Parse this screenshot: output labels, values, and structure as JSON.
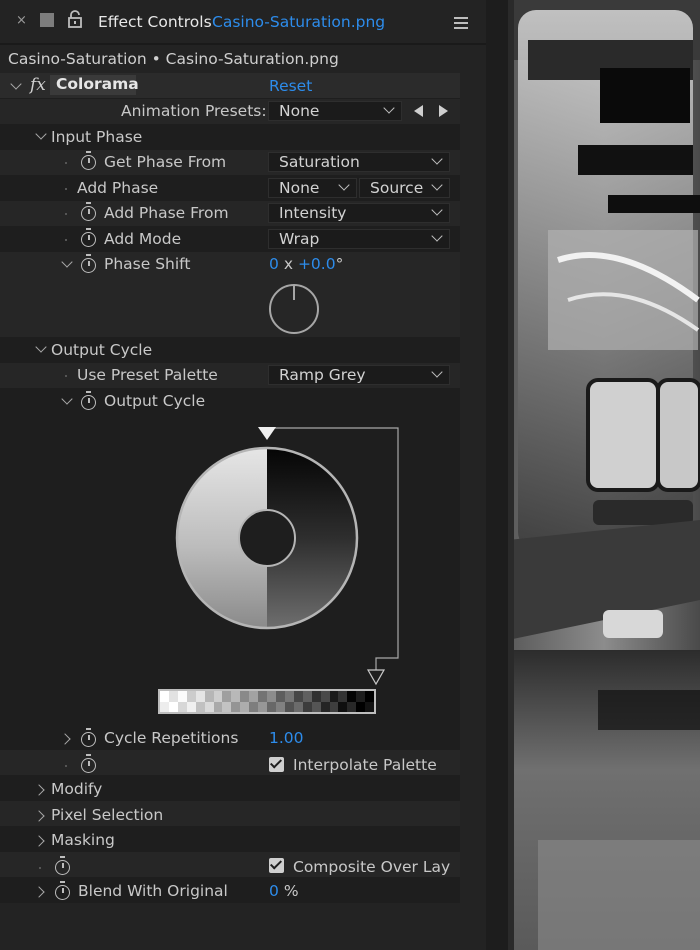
{
  "header": {
    "close": "×",
    "title": "Effect Controls",
    "file": "Casino-Saturation.png"
  },
  "subpath": "Casino-Saturation • Casino-Saturation.png",
  "effect": {
    "badge": "fx",
    "name": "Colorama",
    "reset": "Reset"
  },
  "rows": {
    "animation_presets_label": "Animation Presets:",
    "animation_presets_value": "None",
    "input_phase": "Input Phase",
    "get_phase_from_label": "Get Phase From",
    "get_phase_from_value": "Saturation",
    "add_phase_label": "Add Phase",
    "add_phase_value": "None",
    "add_phase_source": "Source",
    "add_phase_from_label": "Add Phase From",
    "add_phase_from_value": "Intensity",
    "add_mode_label": "Add Mode",
    "add_mode_value": "Wrap",
    "phase_shift_label": "Phase Shift",
    "phase_shift_rev": "0",
    "phase_shift_x": "x",
    "phase_shift_deg": "+0.0",
    "phase_shift_unit": "°",
    "output_cycle_group": "Output Cycle",
    "use_preset_palette_label": "Use Preset Palette",
    "use_preset_palette_value": "Ramp Grey",
    "output_cycle_label": "Output Cycle",
    "cycle_repetitions_label": "Cycle Repetitions",
    "cycle_repetitions_value": "1.00",
    "interpolate_palette_label": "Interpolate Palette",
    "interpolate_palette_checked": true,
    "modify": "Modify",
    "pixel_selection": "Pixel Selection",
    "masking": "Masking",
    "composite_over_layer_label": "Composite Over Lay",
    "composite_over_layer_checked": true,
    "blend_with_original_label": "Blend With Original",
    "blend_with_original_value": "0",
    "blend_with_original_unit": "%"
  },
  "palette": {
    "stops": [
      "#ffffff",
      "#000000"
    ],
    "swatch_count": 24
  },
  "icons": {
    "close": "close-icon",
    "square": "panel-square-icon",
    "lock": "lock-icon",
    "menu": "hamburger-menu-icon",
    "stopwatch": "stopwatch-icon",
    "prev": "previous-arrow-icon",
    "next": "next-arrow-icon"
  },
  "colors": {
    "accent": "#2d8ceb",
    "panel": "#232323"
  }
}
